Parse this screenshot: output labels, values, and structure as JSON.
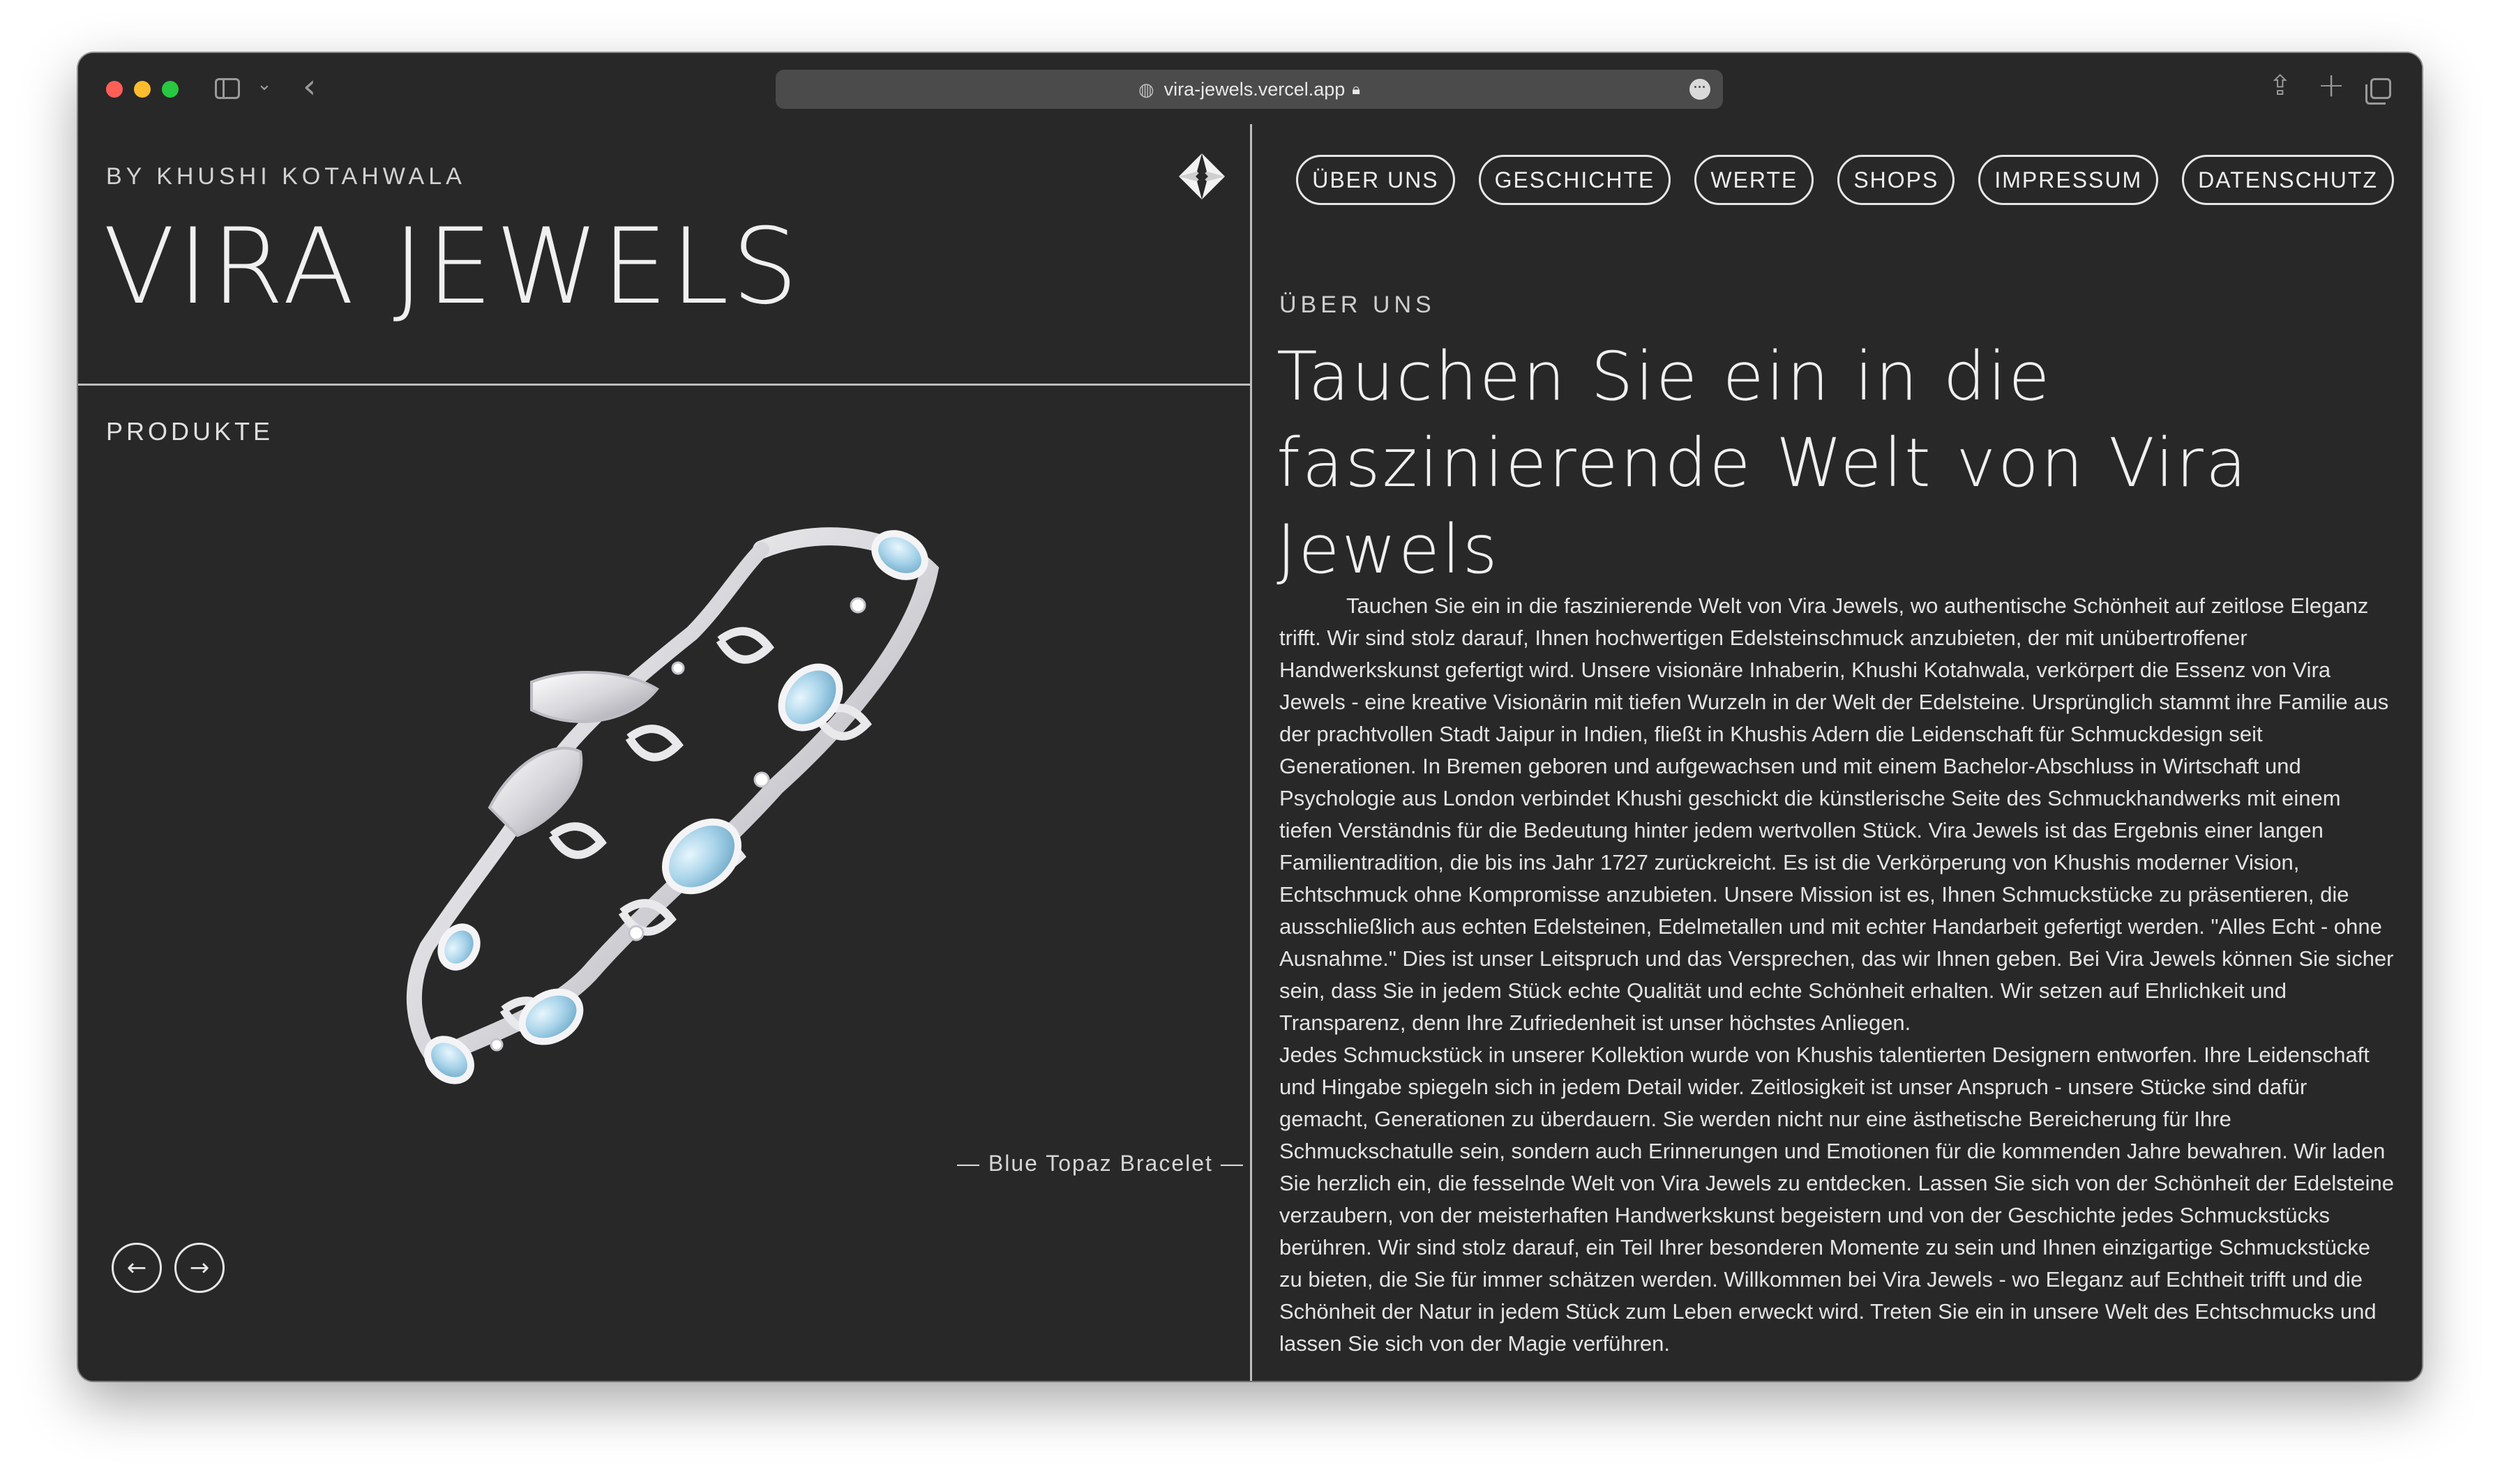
{
  "browser": {
    "url": "vira-jewels.vercel.app"
  },
  "header": {
    "byline": "BY KHUSHI KOTAHWALA",
    "brand": "VIRA JEWELS"
  },
  "nav": {
    "items": [
      "ÜBER UNS",
      "GESCHICHTE",
      "WERTE",
      "SHOPS",
      "IMPRESSUM",
      "DATENSCHUTZ"
    ]
  },
  "products": {
    "label": "PRODUKTE",
    "caption": "— Blue Topaz Bracelet —",
    "prev": "←",
    "next": "→"
  },
  "about": {
    "eyebrow": "ÜBER UNS",
    "heading": "Tauchen Sie ein in die faszinierende Welt von Vira Jewels",
    "paragraph1": "Tauchen Sie ein in die faszinierende Welt von Vira Jewels, wo authentische Schönheit auf zeitlose Eleganz trifft. Wir sind stolz darauf, Ihnen hochwertigen Edelsteinschmuck anzubieten, der mit unübertroffener Handwerkskunst gefertigt wird. Unsere visionäre Inhaberin, Khushi Kotahwala, verkörpert die Essenz von Vira Jewels - eine kreative Visionärin mit tiefen Wurzeln in der Welt der Edelsteine. Ursprünglich stammt ihre Familie aus der prachtvollen Stadt Jaipur in Indien, fließt in Khushis Adern die Leidenschaft für Schmuckdesign seit Generationen. In Bremen geboren und aufgewachsen und mit einem Bachelor-Abschluss in Wirtschaft und Psychologie aus London verbindet Khushi geschickt die künstlerische Seite des Schmuckhandwerks mit einem tiefen Verständnis für die Bedeutung hinter jedem wertvollen Stück. Vira Jewels ist das Ergebnis einer langen Familientradition, die bis ins Jahr 1727 zurückreicht. Es ist die Verkörperung von Khushis moderner Vision, Echtschmuck ohne Kompromisse anzubieten. Unsere Mission ist es, Ihnen Schmuckstücke zu präsentieren, die ausschließlich aus echten Edelsteinen, Edelmetallen und mit echter Handarbeit gefertigt werden. \"Alles Echt - ohne Ausnahme.\" Dies ist unser Leitspruch und das Versprechen, das wir Ihnen geben. Bei Vira Jewels können Sie sicher sein, dass Sie in jedem Stück echte Qualität und echte Schönheit erhalten. Wir setzen auf Ehrlichkeit und Transparenz, denn Ihre Zufriedenheit ist unser höchstes Anliegen.",
    "paragraph2": "Jedes Schmuckstück in unserer Kollektion wurde von Khushis talentierten Designern entworfen. Ihre Leidenschaft und Hingabe spiegeln sich in jedem Detail wider. Zeitlosigkeit ist unser Anspruch - unsere Stücke sind dafür gemacht, Generationen zu überdauern. Sie werden nicht nur eine ästhetische Bereicherung für Ihre Schmuckschatulle sein, sondern auch Erinnerungen und Emotionen für die kommenden Jahre bewahren. Wir laden Sie herzlich ein, die fesselnde Welt von Vira Jewels zu entdecken. Lassen Sie sich von der Schönheit der Edelsteine verzaubern, von der meisterhaften Handwerkskunst begeistern und von der Geschichte jedes Schmuckstücks berühren. Wir sind stolz darauf, ein Teil Ihrer besonderen Momente zu sein und Ihnen einzigartige Schmuckstücke zu bieten, die Sie für immer schätzen werden. Willkommen bei Vira Jewels - wo Eleganz auf Echtheit trifft und die Schönheit der Natur in jedem Stück zum Leben erweckt wird. Treten Sie ein in unsere Welt des Echtschmucks und lassen Sie sich von der Magie verführen."
  },
  "icons": {
    "globe": "globe-icon",
    "lock": "lock-icon",
    "logo": "diamond-logo-icon"
  },
  "colors": {
    "background": "#282828",
    "text": "#e7e7e7",
    "topaz": "#a9d4ea",
    "silver": "#e9e9ec"
  }
}
